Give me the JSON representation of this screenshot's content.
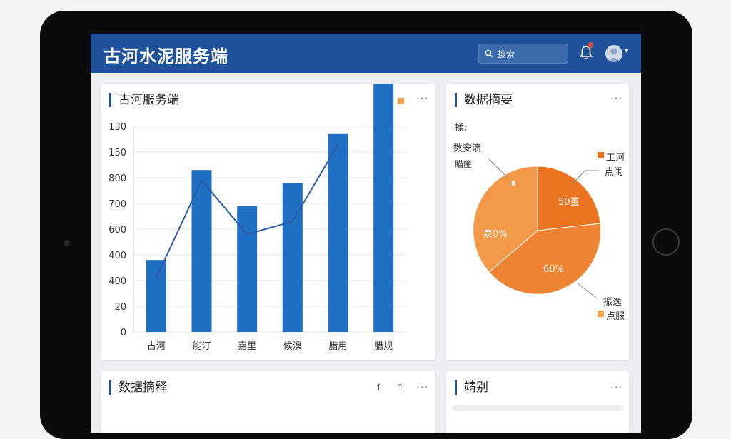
{
  "app": {
    "title": "古河水泥服务端"
  },
  "search": {
    "placeholder": "搜索"
  },
  "colors": {
    "header": "#1f5298",
    "bar": "#1f6fc5",
    "line": "#2e5aa0",
    "pie_dark": "#ea7420",
    "pie_mid": "#ee8431",
    "pie_light": "#f29a4a"
  },
  "bar_card": {
    "title": "古河服务端",
    "legend": [
      {
        "color": "#1f6fc5"
      },
      {
        "color": "#f0a050"
      }
    ]
  },
  "pie_card": {
    "title": "数据摘要",
    "top_text": "揉:",
    "label_top_left_1": "数安渍",
    "label_top_left_2": "瞄篚",
    "label_right_top_1": "工河",
    "label_right_top_2": "点闱",
    "label_right_bottom_1": "振逸",
    "label_right_bottom_2": "点服",
    "slice_label_1": "50畺",
    "slice_label_2": "泉0%",
    "slice_label_3": "60%"
  },
  "bottom_left_card": {
    "title": "数据摘释"
  },
  "bottom_right_card": {
    "title": "靖别"
  },
  "chart_data": {
    "type": "bar",
    "categories": [
      "古河",
      "能汀",
      "嘉里",
      "候溟",
      "腊用",
      "腊规"
    ],
    "y_tick_labels": [
      "0",
      "20",
      "400",
      "400",
      "600",
      "700",
      "800",
      "150",
      "130"
    ],
    "values": [
      2.8,
      6.3,
      4.9,
      5.8,
      7.7,
      9.7
    ],
    "line_values": [
      2.1,
      5.9,
      3.8,
      4.3,
      7.3
    ],
    "grid": true,
    "legend_position": "top-right"
  }
}
